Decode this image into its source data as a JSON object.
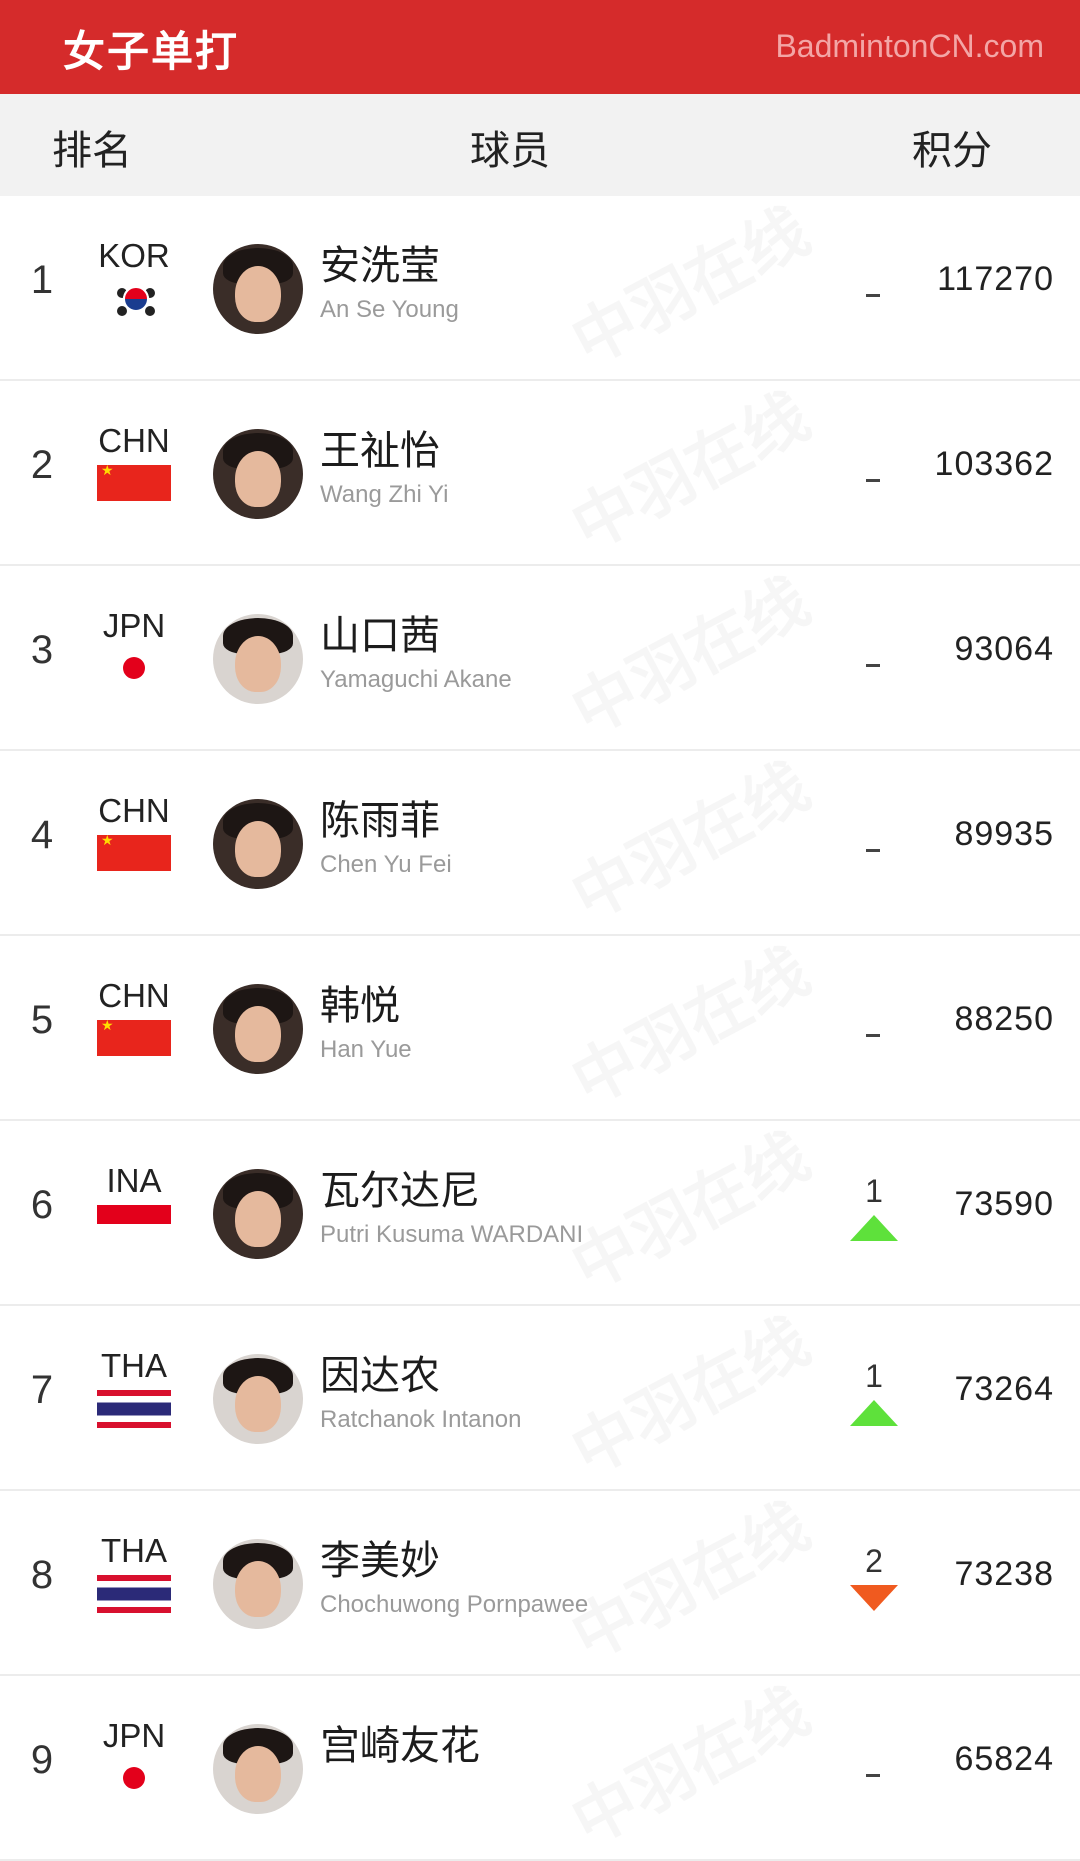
{
  "topbar": {
    "title": "女子单打",
    "site": "BadmintonCN.com"
  },
  "header": {
    "rank": "排名",
    "player": "球员",
    "points": "积分"
  },
  "watermark": "中羽在线",
  "players": [
    {
      "rank": "1",
      "country": "KOR",
      "flag": "kor-flag-icon",
      "name_cn": "安洗莹",
      "name_en": "An Se Young",
      "change": "",
      "trend": "same",
      "points": "117270"
    },
    {
      "rank": "2",
      "country": "CHN",
      "flag": "chn-flag-icon",
      "name_cn": "王祉怡",
      "name_en": "Wang Zhi Yi",
      "change": "",
      "trend": "same",
      "points": "103362"
    },
    {
      "rank": "3",
      "country": "JPN",
      "flag": "jpn-flag-icon",
      "name_cn": "山口茜",
      "name_en": "Yamaguchi Akane",
      "change": "",
      "trend": "same",
      "points": "93064"
    },
    {
      "rank": "4",
      "country": "CHN",
      "flag": "chn-flag-icon",
      "name_cn": "陈雨菲",
      "name_en": "Chen Yu Fei",
      "change": "",
      "trend": "same",
      "points": "89935"
    },
    {
      "rank": "5",
      "country": "CHN",
      "flag": "chn-flag-icon",
      "name_cn": "韩悦",
      "name_en": "Han Yue",
      "change": "",
      "trend": "same",
      "points": "88250"
    },
    {
      "rank": "6",
      "country": "INA",
      "flag": "ina-flag-icon",
      "name_cn": "瓦尔达尼",
      "name_en": "Putri Kusuma WARDANI",
      "change": "1",
      "trend": "up",
      "points": "73590"
    },
    {
      "rank": "7",
      "country": "THA",
      "flag": "tha-flag-icon",
      "name_cn": "因达农",
      "name_en": "Ratchanok Intanon",
      "change": "1",
      "trend": "up",
      "points": "73264"
    },
    {
      "rank": "8",
      "country": "THA",
      "flag": "tha-flag-icon",
      "name_cn": "李美妙",
      "name_en": "Chochuwong Pornpawee",
      "change": "2",
      "trend": "down",
      "points": "73238"
    },
    {
      "rank": "9",
      "country": "JPN",
      "flag": "jpn-flag-icon",
      "name_cn": "宫崎友花",
      "name_en": "",
      "change": "",
      "trend": "same",
      "points": "65824"
    }
  ],
  "colors": {
    "brand_red": "#d52b2b",
    "up_green": "#5ee13b",
    "down_orange": "#f05a1f"
  }
}
